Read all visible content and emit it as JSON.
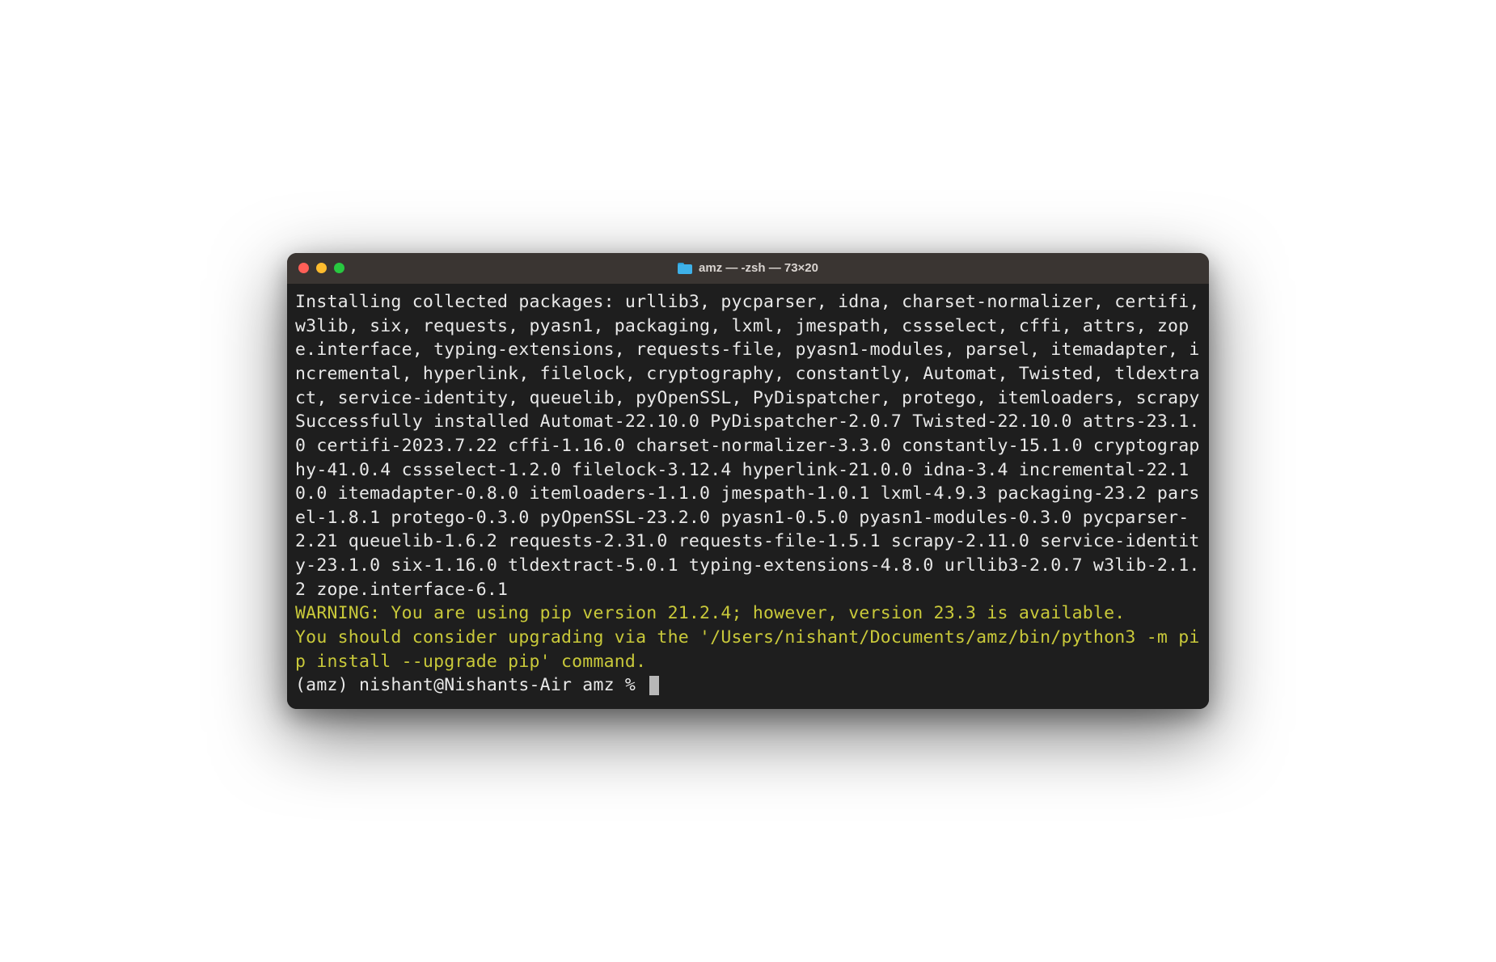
{
  "window": {
    "title": "amz — -zsh — 73×20"
  },
  "terminal": {
    "installing_line": "Installing collected packages: urllib3, pycparser, idna, charset-normalizer, certifi, w3lib, six, requests, pyasn1, packaging, lxml, jmespath, cssselect, cffi, attrs, zope.interface, typing-extensions, requests-file, pyasn1-modules, parsel, itemadapter, incremental, hyperlink, filelock, cryptography, constantly, Automat, Twisted, tldextract, service-identity, queuelib, pyOpenSSL, PyDispatcher, protego, itemloaders, scrapy",
    "success_line": "Successfully installed Automat-22.10.0 PyDispatcher-2.0.7 Twisted-22.10.0 attrs-23.1.0 certifi-2023.7.22 cffi-1.16.0 charset-normalizer-3.3.0 constantly-15.1.0 cryptography-41.0.4 cssselect-1.2.0 filelock-3.12.4 hyperlink-21.0.0 idna-3.4 incremental-22.10.0 itemadapter-0.8.0 itemloaders-1.1.0 jmespath-1.0.1 lxml-4.9.3 packaging-23.2 parsel-1.8.1 protego-0.3.0 pyOpenSSL-23.2.0 pyasn1-0.5.0 pyasn1-modules-0.3.0 pycparser-2.21 queuelib-1.6.2 requests-2.31.0 requests-file-1.5.1 scrapy-2.11.0 service-identity-23.1.0 six-1.16.0 tldextract-5.0.1 typing-extensions-4.8.0 urllib3-2.0.7 w3lib-2.1.2 zope.interface-6.1",
    "warning_line1": "WARNING: You are using pip version 21.2.4; however, version 23.3 is available.",
    "warning_line2": "You should consider upgrading via the '/Users/nishant/Documents/amz/bin/python3 -m pip install --upgrade pip' command.",
    "prompt": "(amz) nishant@Nishants-Air amz % "
  }
}
